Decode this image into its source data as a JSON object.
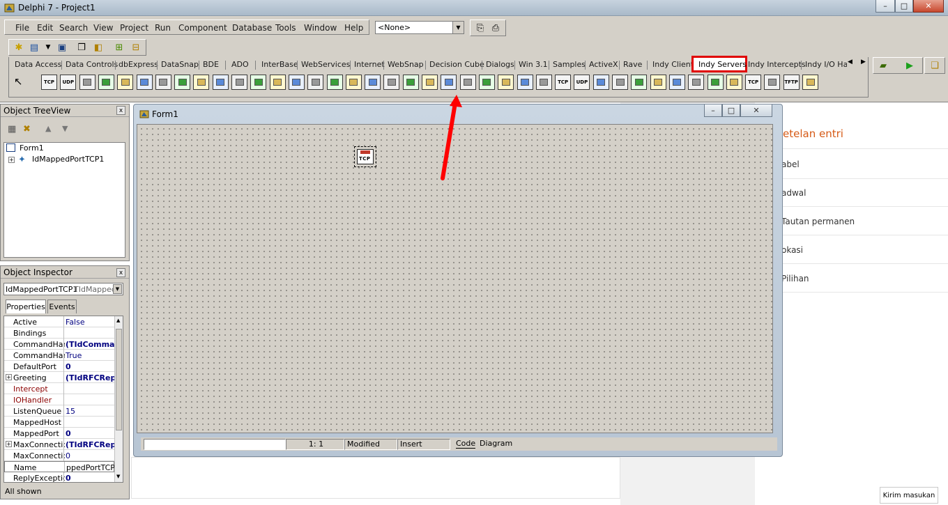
{
  "window": {
    "title": "Delphi 7 - Project1",
    "min_label": "–",
    "max_label": "□",
    "close_label": "✕"
  },
  "menu": [
    "File",
    "Edit",
    "Search",
    "View",
    "Project",
    "Run",
    "Component",
    "Database",
    "Tools",
    "Window",
    "Help"
  ],
  "desktop_combo": {
    "value": "<None>"
  },
  "palette": {
    "tabs": [
      "Data Access",
      "Data Controls",
      "dbExpress",
      "DataSnap",
      "BDE",
      "ADO",
      "InterBase",
      "WebServices",
      "Internet",
      "WebSnap",
      "Decision Cube",
      "Dialogs",
      "Win 3.1",
      "Samples",
      "ActiveX",
      "Rave",
      "Indy Clients",
      "Indy Servers",
      "Indy Intercepts",
      "Indy I/O Han"
    ],
    "active_tab": "Indy Servers",
    "icon_labels": [
      "TCP",
      "UDP",
      "TCP",
      "UDP",
      "TCP",
      "TFTP"
    ]
  },
  "web_page": {
    "heading": "etelan entri",
    "items": [
      "abel",
      "adwal",
      "Tautan permanen",
      "okasi",
      "Pilihan"
    ],
    "feedback_button": "Kirim masukan"
  },
  "object_treeview": {
    "title": "Object TreeView",
    "nodes": [
      "Form1",
      "IdMappedPortTCP1"
    ]
  },
  "object_inspector": {
    "title": "Object Inspector",
    "selected_object": "IdMappedPortTCP1",
    "selected_type": "TIdMappec",
    "tabs": [
      "Properties",
      "Events"
    ],
    "properties": [
      {
        "name": "Active",
        "value": "False"
      },
      {
        "name": "Bindings",
        "value": ""
      },
      {
        "name": "CommandHanc",
        "value": "(TIdCommar"
      },
      {
        "name": "CommandHanc",
        "value": "True"
      },
      {
        "name": "DefaultPort",
        "value": "0"
      },
      {
        "name": "Greeting",
        "value": "(TIdRFCRep"
      },
      {
        "name": "Intercept",
        "value": ""
      },
      {
        "name": "IOHandler",
        "value": ""
      },
      {
        "name": "ListenQueue",
        "value": "15"
      },
      {
        "name": "MappedHost",
        "value": ""
      },
      {
        "name": "MappedPort",
        "value": "0"
      },
      {
        "name": "MaxConnection",
        "value": "(TIdRFCRep"
      },
      {
        "name": "MaxConnection",
        "value": "0"
      },
      {
        "name": "Name",
        "value": "ppedPortTCP1"
      },
      {
        "name": "ReplyException",
        "value": "0"
      }
    ],
    "footer": "All shown"
  },
  "form": {
    "title": "Form1",
    "component_label": "TCP"
  },
  "editor_status": {
    "position": "1:   1",
    "modified": "Modified",
    "mode": "Insert",
    "code_tab": "Code",
    "diagram_tab": "Diagram"
  },
  "colors": {
    "highlight": "#e00000",
    "arrow": "#ff0000"
  }
}
